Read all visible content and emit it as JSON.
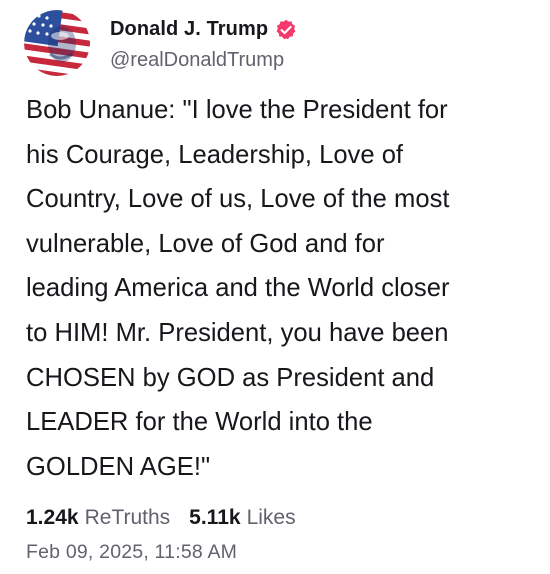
{
  "author": {
    "display_name": "Donald J. Trump",
    "handle": "@realDonaldTrump",
    "avatar_icon": "flag-portrait-avatar",
    "verified_icon": "verified-check-icon",
    "verified_color": "#f43a6b"
  },
  "post": {
    "text": "Bob Unanue: \"I love the President for\nhis Courage, Leadership, Love of\nCountry, Love of us, Love of the most\nvulnerable, Love of God and for\nleading America and the World closer\nto HIM! Mr. President, you have been\nCHOSEN by GOD as President and\nLEADER for the World into the\nGOLDEN AGE!\""
  },
  "stats": {
    "retruths_count": "1.24k",
    "retruths_label": "ReTruths",
    "likes_count": "5.11k",
    "likes_label": "Likes"
  },
  "timestamp": "Feb 09, 2025, 11:58 AM"
}
